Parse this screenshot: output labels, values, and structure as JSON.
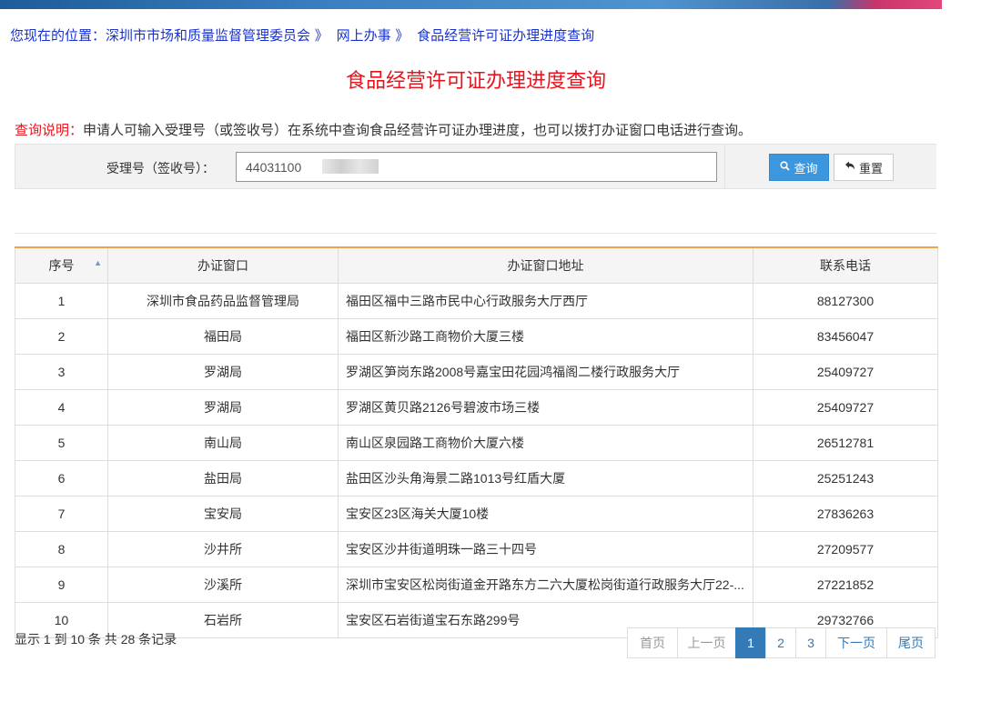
{
  "breadcrumb": {
    "prefix": "您现在的位置：",
    "items": [
      "深圳市市场和质量监督管理委员会 》",
      "网上办事 》",
      "食品经营许可证办理进度查询"
    ]
  },
  "page_title": "食品经营许可证办理进度查询",
  "notice": {
    "label": "查询说明：",
    "text": "申请人可输入受理号（或签收号）在系统中查询食品经营许可证办理进度，也可以拨打办证窗口电话进行查询。"
  },
  "search": {
    "label": "受理号（签收号）：",
    "value": "44031100          7",
    "query_button": "查询",
    "reset_button": "重置"
  },
  "table": {
    "headers": [
      "序号",
      "办证窗口",
      "办证窗口地址",
      "联系电话"
    ],
    "rows": [
      [
        "1",
        "深圳市食品药品监督管理局",
        "福田区福中三路市民中心行政服务大厅西厅",
        "88127300"
      ],
      [
        "2",
        "福田局",
        "福田区新沙路工商物价大厦三楼",
        "83456047"
      ],
      [
        "3",
        "罗湖局",
        "罗湖区笋岗东路2008号嘉宝田花园鸿福阁二楼行政服务大厅",
        "25409727"
      ],
      [
        "4",
        "罗湖局",
        "罗湖区黄贝路2126号碧波市场三楼",
        "25409727"
      ],
      [
        "5",
        "南山局",
        "南山区泉园路工商物价大厦六楼",
        "26512781"
      ],
      [
        "6",
        "盐田局",
        "盐田区沙头角海景二路1013号红盾大厦",
        "25251243"
      ],
      [
        "7",
        "宝安局",
        "宝安区23区海关大厦10楼",
        "27836263"
      ],
      [
        "8",
        "沙井所",
        "宝安区沙井街道明珠一路三十四号",
        "27209577"
      ],
      [
        "9",
        "沙溪所",
        "深圳市宝安区松岗街道金开路东方二六大厦松岗街道行政服务大厅22-...",
        "27221852"
      ],
      [
        "10",
        "石岩所",
        "宝安区石岩街道宝石东路299号",
        "29732766"
      ]
    ]
  },
  "records_text": "显示 1 到 10 条 共 28 条记录",
  "pagination": {
    "first": "首页",
    "prev": "上一页",
    "pages": [
      "1",
      "2",
      "3"
    ],
    "active_page": "1",
    "next": "下一页",
    "last": "尾页"
  },
  "colors": {
    "title_red": "#e8141d",
    "link_blue": "#1a33cc",
    "button_blue": "#3c97de",
    "header_accent": "#f0a34a"
  },
  "icons": {
    "search": "search-icon",
    "reset": "undo-arrow-icon",
    "sort": "sort-asc-icon"
  }
}
